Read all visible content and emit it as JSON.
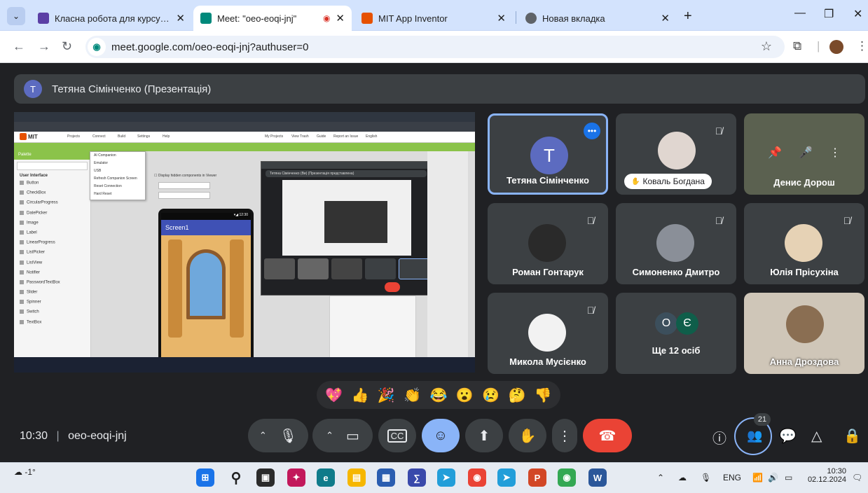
{
  "browser": {
    "tabs": [
      {
        "label": "Класна робота для курсу \"Алг",
        "color": "#5b3fa5",
        "active": false
      },
      {
        "label": "Meet: \"oeo-eoqi-jnj\"",
        "color": "#00897b",
        "active": true
      },
      {
        "label": "MIT App Inventor",
        "color": "#e65100",
        "active": false
      },
      {
        "label": "Новая вкладка",
        "color": "#5f6368",
        "active": false
      }
    ],
    "url": "meet.google.com/oeo-eoqi-jnj?authuser=0"
  },
  "meet": {
    "presenter_initial": "T",
    "presenter_label": "Тетяна Сімінченко (Презентація)",
    "participants": [
      {
        "name": "Тетяна Сімінченко",
        "initial": "T",
        "avatar_color": "#5c6bc0",
        "muted": false,
        "active": true
      },
      {
        "name": "Коваль Богдана",
        "avatar_color": "#e0d6d0",
        "muted": true,
        "active": false
      },
      {
        "name": "Денис Дорош",
        "avatar_color": "#6b6f60",
        "muted": false,
        "active": false
      },
      {
        "name": "Роман Гонтарук",
        "avatar_color": "#2a2a2a",
        "muted": true,
        "active": false
      },
      {
        "name": "Симоненко Дмитро",
        "avatar_color": "#8a8f98",
        "muted": true,
        "active": false
      },
      {
        "name": "Юлія Прісухіна",
        "avatar_color": "#e6d2b5",
        "muted": true,
        "active": false
      },
      {
        "name": "Микола Мусієнко",
        "avatar_color": "#f2f2f2",
        "muted": true,
        "active": false
      },
      {
        "name": "Ще 12 осіб",
        "others": [
          "О",
          "Є"
        ],
        "muted": false,
        "active": false
      },
      {
        "name": "Анна Дроздова",
        "avatar_color": "#c8b49a",
        "muted": false,
        "active": false
      }
    ],
    "time": "10:30",
    "meeting_code": "oeo-eoqi-jnj",
    "participant_count": "21",
    "shared_screen": {
      "app_title": "MIT",
      "menu": [
        "Projects",
        "Connect",
        "Build",
        "Settings",
        "Help"
      ],
      "connect_menu": [
        "AI Companion",
        "Emulator",
        "USB",
        "Refresh Companion Screen",
        "Reset Connection",
        "Hard Reset"
      ],
      "right_menu": [
        "My Projects",
        "View Trash",
        "Guide",
        "Report an Issue",
        "English"
      ],
      "palette_header": "Palette",
      "palette_section": "User Interface",
      "palette_items": [
        "Button",
        "CheckBox",
        "CircularProgress",
        "DatePicker",
        "Image",
        "Label",
        "LinearProgress",
        "ListPicker",
        "ListView",
        "Notifier",
        "PasswordTextBox",
        "Slider",
        "Spinner",
        "Switch",
        "TextBox"
      ],
      "screen_title": "Screen1",
      "inner_title": "Тетяна Сімінченко (Ви) (Презентація представлена)"
    }
  },
  "taskbar": {
    "weather": "-1°",
    "lang": "ENG",
    "time": "10:30",
    "date": "02.12.2024"
  }
}
